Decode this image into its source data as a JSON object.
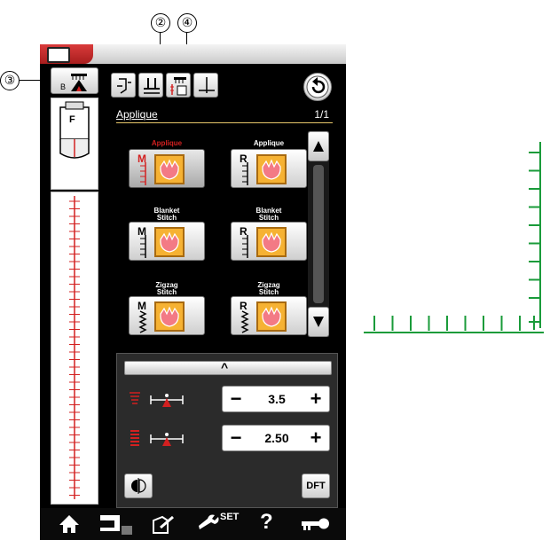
{
  "callouts": [
    "②",
    "③",
    "④"
  ],
  "panel": {
    "title": "Applique",
    "page": "1/1"
  },
  "stitches": [
    {
      "label": "Applique",
      "letter": "M",
      "selected": true
    },
    {
      "label": "Applique",
      "letter": "R",
      "selected": false
    },
    {
      "label": "Blanket Stitch",
      "letter": "M",
      "selected": false
    },
    {
      "label": "Blanket Stitch",
      "letter": "R",
      "selected": false
    },
    {
      "label": "Zigzag Stitch",
      "letter": "M",
      "selected": false
    },
    {
      "label": "Zigzag Stitch",
      "letter": "R",
      "selected": false
    }
  ],
  "settings": {
    "width": {
      "value": "3.5",
      "minus": "−",
      "plus": "+"
    },
    "length": {
      "value": "2.50",
      "minus": "−",
      "plus": "+"
    }
  },
  "buttons": {
    "dft": "DFT",
    "collapse": "^"
  },
  "footer": {
    "set_label": "SET",
    "help_label": "?"
  },
  "foot_label": "F",
  "colors": {
    "accent_red": "#d32020",
    "guide_green": "#1a9b3a",
    "title_line": "#e7c66b"
  }
}
